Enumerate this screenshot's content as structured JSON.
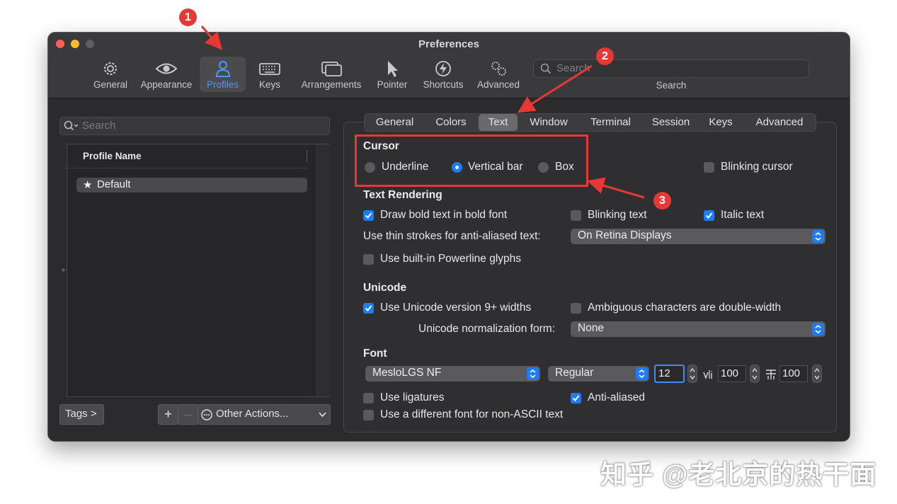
{
  "window": {
    "title": "Preferences"
  },
  "toolbar": {
    "items": [
      {
        "label": "General",
        "icon": "gear-icon"
      },
      {
        "label": "Appearance",
        "icon": "eye-icon"
      },
      {
        "label": "Profiles",
        "icon": "person-icon",
        "selected": true
      },
      {
        "label": "Keys",
        "icon": "keyboard-icon"
      },
      {
        "label": "Arrangements",
        "icon": "windows-icon"
      },
      {
        "label": "Pointer",
        "icon": "pointer-icon"
      },
      {
        "label": "Shortcuts",
        "icon": "bolt-icon"
      },
      {
        "label": "Advanced",
        "icon": "gears-icon"
      }
    ],
    "search_placeholder": "Search",
    "search_label": "Search"
  },
  "sidebar": {
    "search_placeholder": "Search",
    "column_header": "Profile Name",
    "profiles": [
      {
        "name": "Default",
        "star": "★"
      }
    ],
    "tags_button": "Tags >",
    "add_button": "+",
    "remove_button": "—",
    "other_actions": "Other Actions..."
  },
  "tabs": [
    "General",
    "Colors",
    "Text",
    "Window",
    "Terminal",
    "Session",
    "Keys",
    "Advanced"
  ],
  "selected_tab": "Text",
  "cursor": {
    "heading": "Cursor",
    "options": [
      "Underline",
      "Vertical bar",
      "Box"
    ],
    "selected": "Vertical bar",
    "blinking_label": "Blinking cursor",
    "blinking": false
  },
  "text_rendering": {
    "heading": "Text Rendering",
    "bold_label": "Draw bold text in bold font",
    "bold": true,
    "blinking_text_label": "Blinking text",
    "blinking_text": false,
    "italic_label": "Italic text",
    "italic": true,
    "thin_strokes_label": "Use thin strokes for anti-aliased text:",
    "thin_strokes_value": "On Retina Displays",
    "powerline_label": "Use built-in Powerline glyphs",
    "powerline": false
  },
  "unicode": {
    "heading": "Unicode",
    "v9_label": "Use Unicode version 9+ widths",
    "v9": true,
    "ambiguous_label": "Ambiguous characters are double-width",
    "ambiguous": false,
    "normalization_label": "Unicode normalization form:",
    "normalization_value": "None"
  },
  "font": {
    "heading": "Font",
    "family": "MesloLGS NF",
    "style": "Regular",
    "size": "12",
    "h_spacing": "100",
    "v_spacing": "100",
    "ligatures_label": "Use ligatures",
    "ligatures": false,
    "antialiased_label": "Anti-aliased",
    "antialiased": true,
    "non_ascii_label": "Use a different font for non-ASCII text",
    "non_ascii": false
  },
  "annotations": {
    "badges": [
      "1",
      "2",
      "3"
    ],
    "color": "#e53935"
  },
  "watermark": "知乎 @老北京的热干面",
  "colors": {
    "accent": "#1f7cf7",
    "selected_toolbar_text": "#4a9af5",
    "window_bg": "#2b2b2d"
  }
}
